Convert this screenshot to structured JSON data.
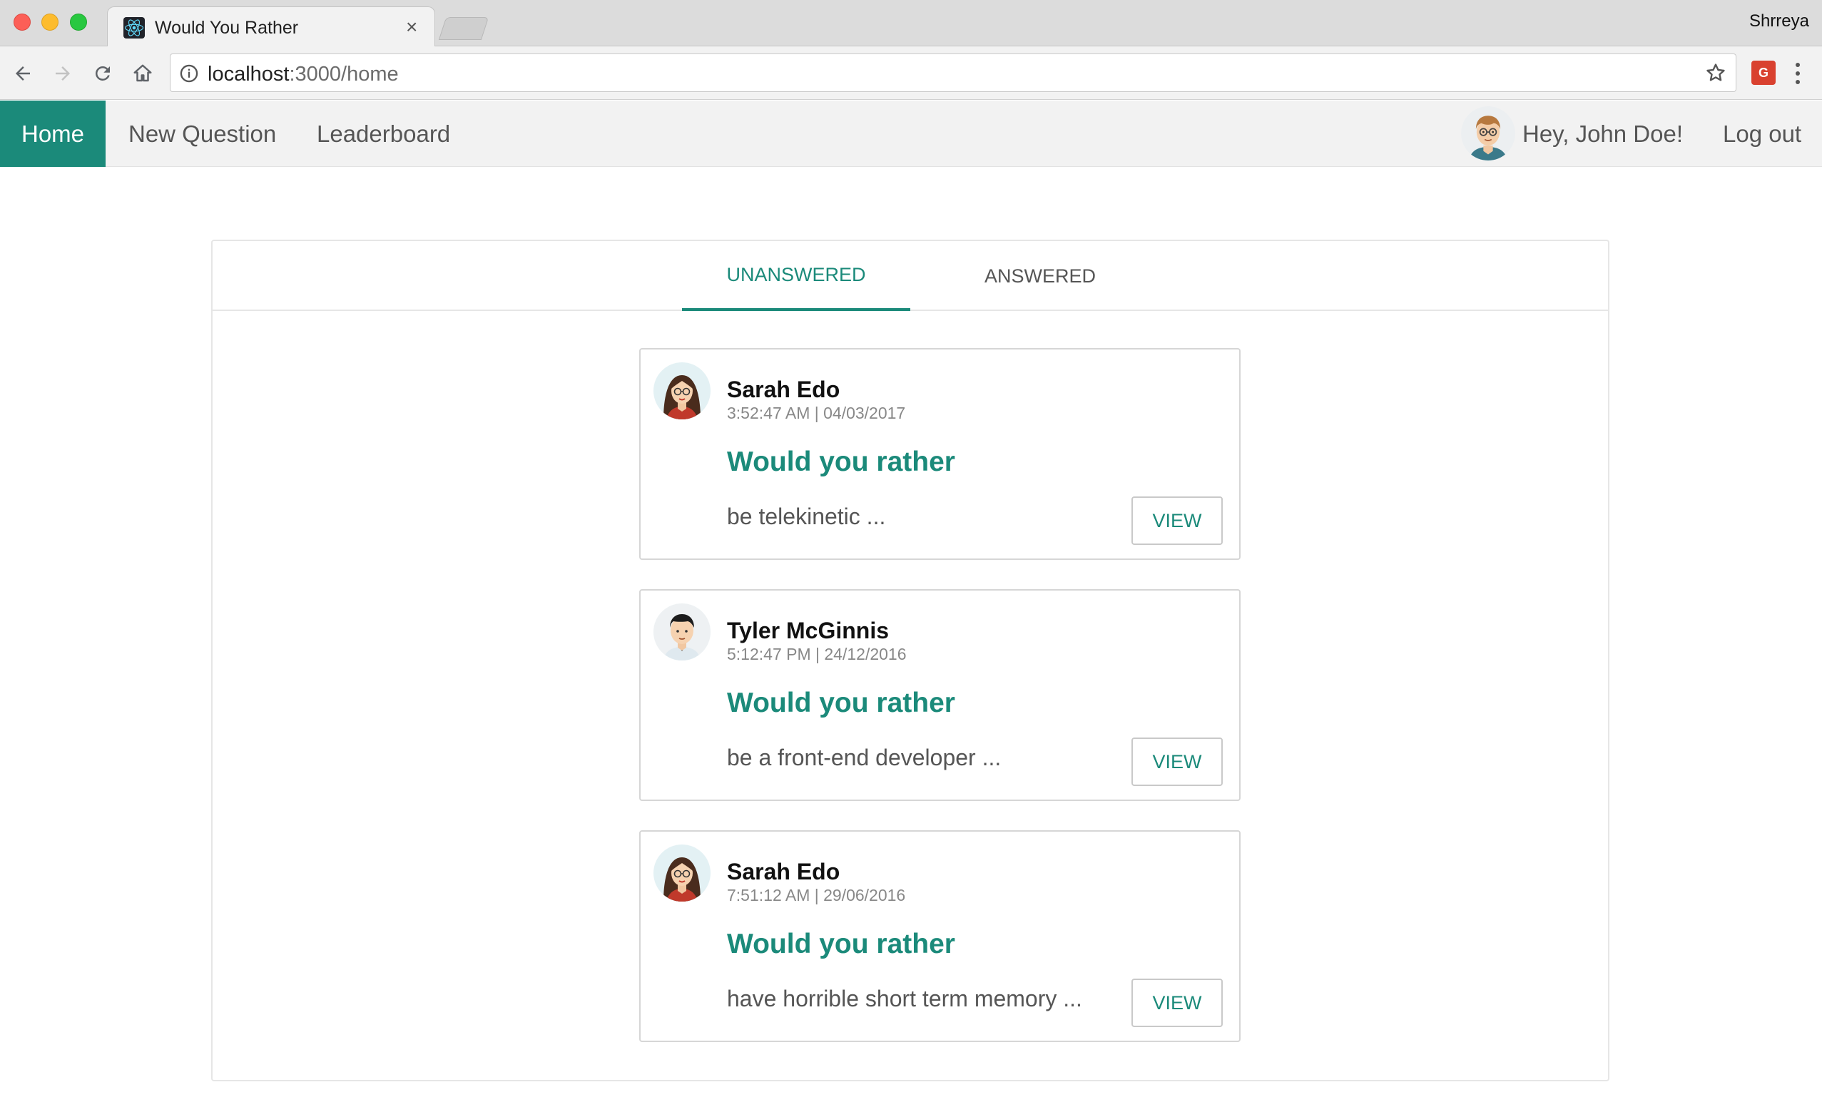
{
  "browser": {
    "tab_title": "Would You Rather",
    "tab_close": "×",
    "profile": "Shrreya",
    "url_host": "localhost",
    "url_path": ":3000/home",
    "extension_label": "G"
  },
  "nav": {
    "home": "Home",
    "new_question": "New Question",
    "leaderboard": "Leaderboard",
    "greeting": "Hey, John Doe!",
    "logout": "Log out"
  },
  "tabs": {
    "unanswered": "UNANSWERED",
    "answered": "ANSWERED",
    "active": "unanswered"
  },
  "questions": [
    {
      "author": "Sarah Edo",
      "timestamp": "3:52:47 AM | 04/03/2017",
      "heading": "Would you rather",
      "option": "be telekinetic ...",
      "button": "VIEW",
      "avatar": "female-avatar-icon"
    },
    {
      "author": "Tyler McGinnis",
      "timestamp": "5:12:47 PM | 24/12/2016",
      "heading": "Would you rather",
      "option": "be a front-end developer ...",
      "button": "VIEW",
      "avatar": "male-avatar-icon"
    },
    {
      "author": "Sarah Edo",
      "timestamp": "7:51:12 AM | 29/06/2016",
      "heading": "Would you rather",
      "option": "have horrible short term memory ...",
      "button": "VIEW",
      "avatar": "female-avatar-icon"
    }
  ],
  "colors": {
    "accent": "#1b8a7a",
    "nav_bg": "#f2f2f2",
    "text_muted": "#888888"
  }
}
